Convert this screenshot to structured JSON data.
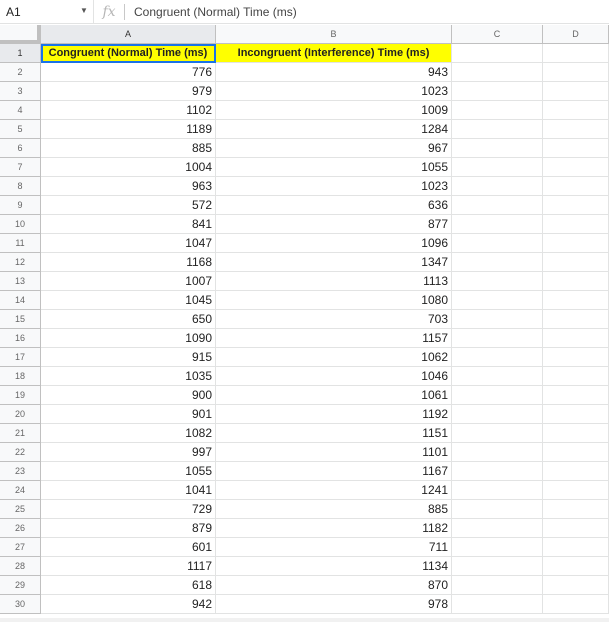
{
  "name_box": "A1",
  "formula_bar_content": "Congruent (Normal) Time (ms)",
  "fx_label": "fx",
  "columns": [
    "A",
    "B",
    "C",
    "D"
  ],
  "row_numbers": [
    "1",
    "2",
    "3",
    "4",
    "5",
    "6",
    "7",
    "8",
    "9",
    "10",
    "11",
    "12",
    "13",
    "14",
    "15",
    "16",
    "17",
    "18",
    "19",
    "20",
    "21",
    "22",
    "23",
    "24",
    "25",
    "26",
    "27",
    "28",
    "29",
    "30"
  ],
  "headers": {
    "a": "Congruent (Normal) Time (ms)",
    "b": "Incongruent (Interference) Time (ms)"
  },
  "rows": [
    {
      "a": "776",
      "b": "943"
    },
    {
      "a": "979",
      "b": "1023"
    },
    {
      "a": "1102",
      "b": "1009"
    },
    {
      "a": "1189",
      "b": "1284"
    },
    {
      "a": "885",
      "b": "967"
    },
    {
      "a": "1004",
      "b": "1055"
    },
    {
      "a": "963",
      "b": "1023"
    },
    {
      "a": "572",
      "b": "636"
    },
    {
      "a": "841",
      "b": "877"
    },
    {
      "a": "1047",
      "b": "1096"
    },
    {
      "a": "1168",
      "b": "1347"
    },
    {
      "a": "1007",
      "b": "1113"
    },
    {
      "a": "1045",
      "b": "1080"
    },
    {
      "a": "650",
      "b": "703"
    },
    {
      "a": "1090",
      "b": "1157"
    },
    {
      "a": "915",
      "b": "1062"
    },
    {
      "a": "1035",
      "b": "1046"
    },
    {
      "a": "900",
      "b": "1061"
    },
    {
      "a": "901",
      "b": "1192"
    },
    {
      "a": "1082",
      "b": "1151"
    },
    {
      "a": "997",
      "b": "1101"
    },
    {
      "a": "1055",
      "b": "1167"
    },
    {
      "a": "1041",
      "b": "1241"
    },
    {
      "a": "729",
      "b": "885"
    },
    {
      "a": "879",
      "b": "1182"
    },
    {
      "a": "601",
      "b": "711"
    },
    {
      "a": "1117",
      "b": "1134"
    },
    {
      "a": "618",
      "b": "870"
    },
    {
      "a": "942",
      "b": "978"
    }
  ],
  "colors": {
    "header_fill": "#ffff00",
    "selection": "#1a73e8"
  }
}
